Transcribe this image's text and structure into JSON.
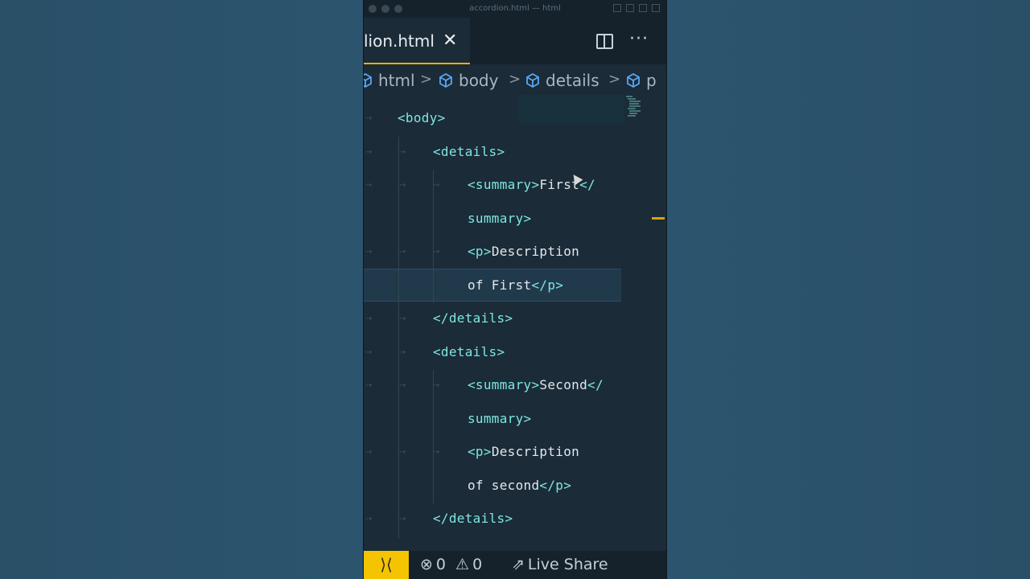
{
  "window": {
    "title": "accordion.html — html"
  },
  "tab": {
    "name": "lion.html",
    "close": "✕"
  },
  "breadcrumb": {
    "items": [
      "html",
      "body",
      "details",
      "p"
    ]
  },
  "editor": {
    "lines": [
      {
        "tag_open": "<body>",
        "text": "",
        "tag_close": ""
      },
      {
        "tag_open": "<details>",
        "text": "",
        "tag_close": ""
      },
      {
        "tag_open": "<summary>",
        "text": "First",
        "tag_close": "</"
      },
      {
        "tag_open": "summary>",
        "text": "",
        "tag_close": ""
      },
      {
        "tag_open": "<p>",
        "text": "Description",
        "tag_close": ""
      },
      {
        "tag_open": "",
        "text": "of First",
        "tag_close": "</p>"
      },
      {
        "tag_open": "</details>",
        "text": "",
        "tag_close": ""
      },
      {
        "tag_open": "<details>",
        "text": "",
        "tag_close": ""
      },
      {
        "tag_open": "<summary>",
        "text": "Second",
        "tag_close": "</"
      },
      {
        "tag_open": "summary>",
        "text": "",
        "tag_close": ""
      },
      {
        "tag_open": "<p>",
        "text": "Description",
        "tag_close": ""
      },
      {
        "tag_open": "",
        "text": "of second",
        "tag_close": "</p>"
      },
      {
        "tag_open": "</details>",
        "text": "",
        "tag_close": ""
      }
    ]
  },
  "statusbar": {
    "errors": "0",
    "warnings": "0",
    "live_share": "Live Share"
  },
  "colors": {
    "accent": "#e8b300",
    "tag": "#7ee6e0"
  }
}
